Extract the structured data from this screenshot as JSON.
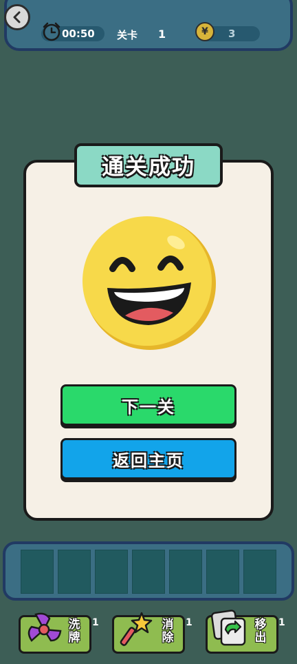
{
  "hud": {
    "timer": "00:50",
    "level_label": "关卡",
    "level_value": "1",
    "coin_symbol": "¥",
    "coins": "3"
  },
  "dialog": {
    "title": "通关成功",
    "next_button": "下一关",
    "home_button": "返回主页"
  },
  "tray": {
    "slots": 7
  },
  "powerups": [
    {
      "label_top": "洗",
      "label_bottom": "牌",
      "count": "1",
      "icon": "fan-icon"
    },
    {
      "label_top": "消",
      "label_bottom": "除",
      "count": "1",
      "icon": "magic-wand-icon"
    },
    {
      "label_top": "移",
      "label_bottom": "出",
      "count": "1",
      "icon": "move-out-icon"
    }
  ],
  "colors": {
    "background": "#3d5e56",
    "hud": "#3b6e84",
    "next_button": "#2ad96b",
    "home_button": "#12a4ea",
    "banner": "#8bd9c5",
    "powerup": "#8fbc50"
  }
}
